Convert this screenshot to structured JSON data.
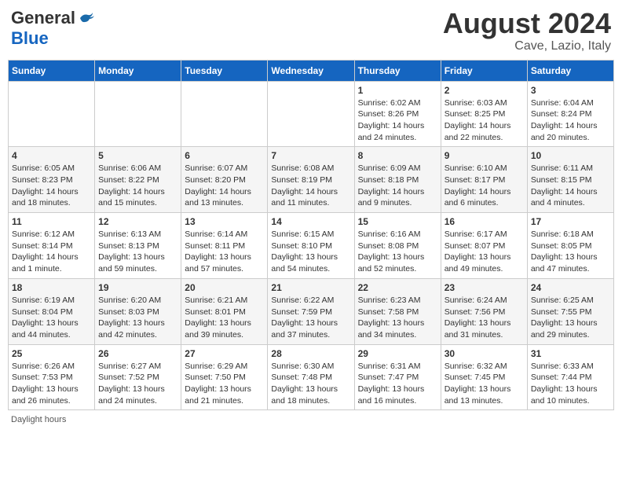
{
  "header": {
    "logo_general": "General",
    "logo_blue": "Blue",
    "month": "August 2024",
    "location": "Cave, Lazio, Italy"
  },
  "days_of_week": [
    "Sunday",
    "Monday",
    "Tuesday",
    "Wednesday",
    "Thursday",
    "Friday",
    "Saturday"
  ],
  "weeks": [
    [
      {
        "day": "",
        "info": ""
      },
      {
        "day": "",
        "info": ""
      },
      {
        "day": "",
        "info": ""
      },
      {
        "day": "",
        "info": ""
      },
      {
        "day": "1",
        "info": "Sunrise: 6:02 AM\nSunset: 8:26 PM\nDaylight: 14 hours and 24 minutes."
      },
      {
        "day": "2",
        "info": "Sunrise: 6:03 AM\nSunset: 8:25 PM\nDaylight: 14 hours and 22 minutes."
      },
      {
        "day": "3",
        "info": "Sunrise: 6:04 AM\nSunset: 8:24 PM\nDaylight: 14 hours and 20 minutes."
      }
    ],
    [
      {
        "day": "4",
        "info": "Sunrise: 6:05 AM\nSunset: 8:23 PM\nDaylight: 14 hours and 18 minutes."
      },
      {
        "day": "5",
        "info": "Sunrise: 6:06 AM\nSunset: 8:22 PM\nDaylight: 14 hours and 15 minutes."
      },
      {
        "day": "6",
        "info": "Sunrise: 6:07 AM\nSunset: 8:20 PM\nDaylight: 14 hours and 13 minutes."
      },
      {
        "day": "7",
        "info": "Sunrise: 6:08 AM\nSunset: 8:19 PM\nDaylight: 14 hours and 11 minutes."
      },
      {
        "day": "8",
        "info": "Sunrise: 6:09 AM\nSunset: 8:18 PM\nDaylight: 14 hours and 9 minutes."
      },
      {
        "day": "9",
        "info": "Sunrise: 6:10 AM\nSunset: 8:17 PM\nDaylight: 14 hours and 6 minutes."
      },
      {
        "day": "10",
        "info": "Sunrise: 6:11 AM\nSunset: 8:15 PM\nDaylight: 14 hours and 4 minutes."
      }
    ],
    [
      {
        "day": "11",
        "info": "Sunrise: 6:12 AM\nSunset: 8:14 PM\nDaylight: 14 hours and 1 minute."
      },
      {
        "day": "12",
        "info": "Sunrise: 6:13 AM\nSunset: 8:13 PM\nDaylight: 13 hours and 59 minutes."
      },
      {
        "day": "13",
        "info": "Sunrise: 6:14 AM\nSunset: 8:11 PM\nDaylight: 13 hours and 57 minutes."
      },
      {
        "day": "14",
        "info": "Sunrise: 6:15 AM\nSunset: 8:10 PM\nDaylight: 13 hours and 54 minutes."
      },
      {
        "day": "15",
        "info": "Sunrise: 6:16 AM\nSunset: 8:08 PM\nDaylight: 13 hours and 52 minutes."
      },
      {
        "day": "16",
        "info": "Sunrise: 6:17 AM\nSunset: 8:07 PM\nDaylight: 13 hours and 49 minutes."
      },
      {
        "day": "17",
        "info": "Sunrise: 6:18 AM\nSunset: 8:05 PM\nDaylight: 13 hours and 47 minutes."
      }
    ],
    [
      {
        "day": "18",
        "info": "Sunrise: 6:19 AM\nSunset: 8:04 PM\nDaylight: 13 hours and 44 minutes."
      },
      {
        "day": "19",
        "info": "Sunrise: 6:20 AM\nSunset: 8:03 PM\nDaylight: 13 hours and 42 minutes."
      },
      {
        "day": "20",
        "info": "Sunrise: 6:21 AM\nSunset: 8:01 PM\nDaylight: 13 hours and 39 minutes."
      },
      {
        "day": "21",
        "info": "Sunrise: 6:22 AM\nSunset: 7:59 PM\nDaylight: 13 hours and 37 minutes."
      },
      {
        "day": "22",
        "info": "Sunrise: 6:23 AM\nSunset: 7:58 PM\nDaylight: 13 hours and 34 minutes."
      },
      {
        "day": "23",
        "info": "Sunrise: 6:24 AM\nSunset: 7:56 PM\nDaylight: 13 hours and 31 minutes."
      },
      {
        "day": "24",
        "info": "Sunrise: 6:25 AM\nSunset: 7:55 PM\nDaylight: 13 hours and 29 minutes."
      }
    ],
    [
      {
        "day": "25",
        "info": "Sunrise: 6:26 AM\nSunset: 7:53 PM\nDaylight: 13 hours and 26 minutes."
      },
      {
        "day": "26",
        "info": "Sunrise: 6:27 AM\nSunset: 7:52 PM\nDaylight: 13 hours and 24 minutes."
      },
      {
        "day": "27",
        "info": "Sunrise: 6:29 AM\nSunset: 7:50 PM\nDaylight: 13 hours and 21 minutes."
      },
      {
        "day": "28",
        "info": "Sunrise: 6:30 AM\nSunset: 7:48 PM\nDaylight: 13 hours and 18 minutes."
      },
      {
        "day": "29",
        "info": "Sunrise: 6:31 AM\nSunset: 7:47 PM\nDaylight: 13 hours and 16 minutes."
      },
      {
        "day": "30",
        "info": "Sunrise: 6:32 AM\nSunset: 7:45 PM\nDaylight: 13 hours and 13 minutes."
      },
      {
        "day": "31",
        "info": "Sunrise: 6:33 AM\nSunset: 7:44 PM\nDaylight: 13 hours and 10 minutes."
      }
    ]
  ],
  "footer": "Daylight hours"
}
